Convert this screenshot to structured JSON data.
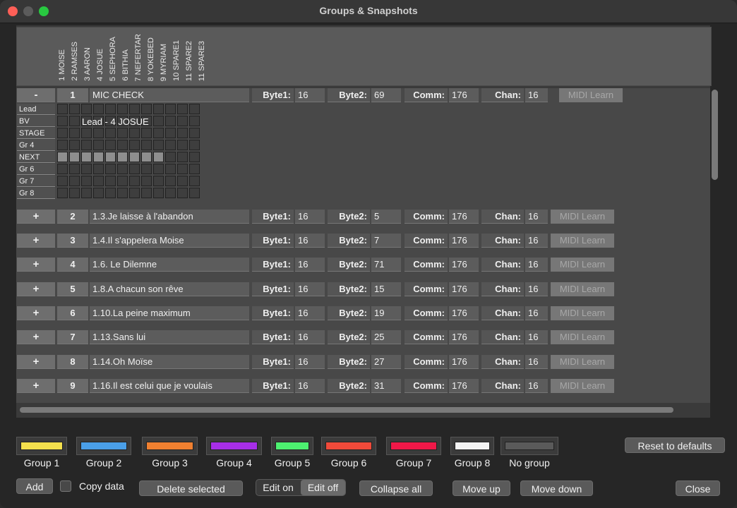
{
  "window": {
    "title": "Groups & Snapshots"
  },
  "channels": [
    "1 MOISE",
    "2 RAMSES",
    "3 AARON",
    "4 JOSUE",
    "5 SEPHORA",
    "6 BITHIA",
    "7 NEFERTAR",
    "8 YOKEBED",
    "9 MYRIAM",
    "10 SPARE1",
    "11 SPARE2",
    "11 SPARE3"
  ],
  "labels": {
    "byte1": "Byte1:",
    "byte2": "Byte2:",
    "comm": "Comm:",
    "chan": "Chan:",
    "midi": "MIDI Learn"
  },
  "snapshots": [
    {
      "toggle": "-",
      "num": "1",
      "name": "MIC CHECK",
      "byte1": "16",
      "byte2": "69",
      "comm": "176",
      "chan": "16"
    },
    {
      "toggle": "+",
      "num": "2",
      "name": "1.3.Je laisse à l'abandon",
      "byte1": "16",
      "byte2": "5",
      "comm": "176",
      "chan": "16"
    },
    {
      "toggle": "+",
      "num": "3",
      "name": "1.4.Il s'appelera Moise",
      "byte1": "16",
      "byte2": "7",
      "comm": "176",
      "chan": "16"
    },
    {
      "toggle": "+",
      "num": "4",
      "name": "1.6. Le Dilemne",
      "byte1": "16",
      "byte2": "71",
      "comm": "176",
      "chan": "16"
    },
    {
      "toggle": "+",
      "num": "5",
      "name": "1.8.A chacun son rêve",
      "byte1": "16",
      "byte2": "15",
      "comm": "176",
      "chan": "16"
    },
    {
      "toggle": "+",
      "num": "6",
      "name": "1.10.La peine maximum",
      "byte1": "16",
      "byte2": "19",
      "comm": "176",
      "chan": "16"
    },
    {
      "toggle": "+",
      "num": "7",
      "name": "1.13.Sans lui",
      "byte1": "16",
      "byte2": "25",
      "comm": "176",
      "chan": "16"
    },
    {
      "toggle": "+",
      "num": "8",
      "name": "1.14.Oh Moïse",
      "byte1": "16",
      "byte2": "27",
      "comm": "176",
      "chan": "16"
    },
    {
      "toggle": "+",
      "num": "9",
      "name": "1.16.Il est celui que je voulais",
      "byte1": "16",
      "byte2": "31",
      "comm": "176",
      "chan": "16"
    }
  ],
  "grid": {
    "rows": [
      "Lead",
      "BV",
      "STAGE",
      "Gr 4",
      "NEXT",
      "Gr 6",
      "Gr 7",
      "Gr 8"
    ],
    "highlight_row": "NEXT",
    "highlight_count": 9,
    "tooltip": "Lead - 4 JOSUE"
  },
  "groups": [
    {
      "label": "Group 1",
      "color": "#f4e04d"
    },
    {
      "label": "Group 2",
      "color": "#4a9fe8"
    },
    {
      "label": "Group 3",
      "color": "#f08030"
    },
    {
      "label": "Group 4",
      "color": "#a72ee8"
    },
    {
      "label": "Group 5",
      "color": "#4df070"
    },
    {
      "label": "Group 6",
      "color": "#f04a3a"
    },
    {
      "label": "Group 7",
      "color": "#f01848"
    },
    {
      "label": "Group 8",
      "color": "#f4f4f4"
    },
    {
      "label": "No group",
      "color": "#5a5a5a"
    }
  ],
  "buttons": {
    "reset": "Reset to defaults",
    "add": "Add",
    "copy": "Copy data",
    "delete": "Delete selected",
    "edit_on": "Edit on",
    "edit_off": "Edit off",
    "collapse": "Collapse all",
    "move_up": "Move up",
    "move_down": "Move down",
    "close": "Close"
  }
}
